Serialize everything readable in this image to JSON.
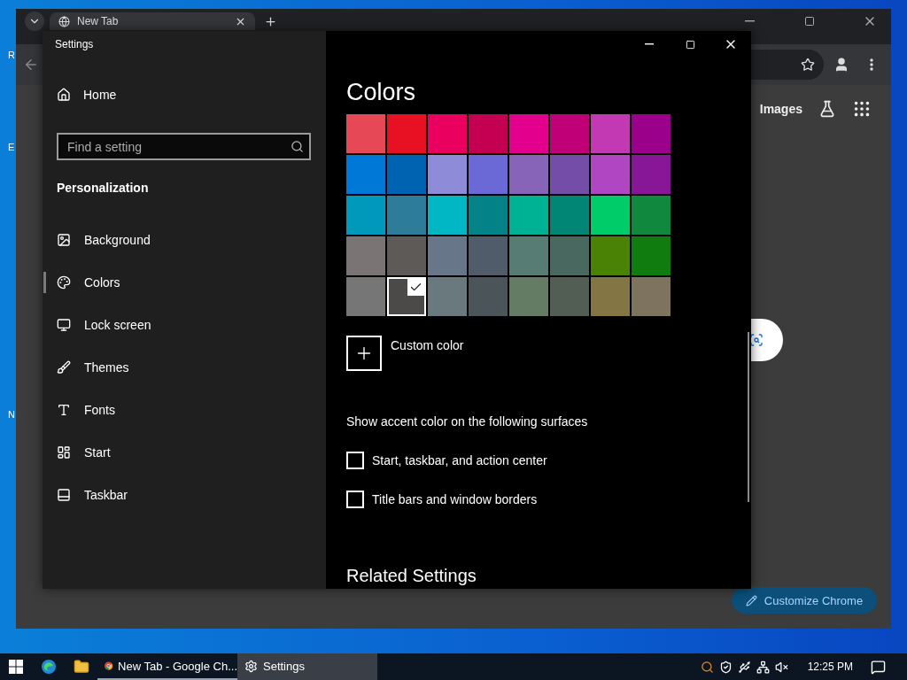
{
  "desktop": {
    "labels": [
      "R",
      "E",
      "N"
    ]
  },
  "browser": {
    "tab": {
      "title": "New Tab"
    },
    "images_link": "Images",
    "customize_button": "Customize Chrome"
  },
  "settings": {
    "title": "Settings",
    "home": "Home",
    "search": {
      "placeholder": "Find a setting"
    },
    "section": "Personalization",
    "nav": [
      {
        "label": "Background",
        "kind": "background",
        "selected": false
      },
      {
        "label": "Colors",
        "kind": "colors",
        "selected": true
      },
      {
        "label": "Lock screen",
        "kind": "lock",
        "selected": false
      },
      {
        "label": "Themes",
        "kind": "themes",
        "selected": false
      },
      {
        "label": "Fonts",
        "kind": "fonts",
        "selected": false
      },
      {
        "label": "Start",
        "kind": "start",
        "selected": false
      },
      {
        "label": "Taskbar",
        "kind": "taskbar",
        "selected": false
      }
    ],
    "page_title": "Colors",
    "swatches": [
      {
        "color": "#e74856",
        "selected": false
      },
      {
        "color": "#e81123",
        "selected": false
      },
      {
        "color": "#ea005e",
        "selected": false
      },
      {
        "color": "#c30052",
        "selected": false
      },
      {
        "color": "#e3008c",
        "selected": false
      },
      {
        "color": "#bf0077",
        "selected": false
      },
      {
        "color": "#c239b3",
        "selected": false
      },
      {
        "color": "#9a0089",
        "selected": false
      },
      {
        "color": "#0078d7",
        "selected": false
      },
      {
        "color": "#0063b1",
        "selected": false
      },
      {
        "color": "#8e8cd8",
        "selected": false
      },
      {
        "color": "#6b69d6",
        "selected": false
      },
      {
        "color": "#8764b8",
        "selected": false
      },
      {
        "color": "#744da9",
        "selected": false
      },
      {
        "color": "#b146c2",
        "selected": false
      },
      {
        "color": "#881798",
        "selected": false
      },
      {
        "color": "#0099bc",
        "selected": false
      },
      {
        "color": "#2d7d9a",
        "selected": false
      },
      {
        "color": "#00b7c3",
        "selected": false
      },
      {
        "color": "#038387",
        "selected": false
      },
      {
        "color": "#00b294",
        "selected": false
      },
      {
        "color": "#018574",
        "selected": false
      },
      {
        "color": "#00cc6a",
        "selected": false
      },
      {
        "color": "#10893e",
        "selected": false
      },
      {
        "color": "#7a7574",
        "selected": false
      },
      {
        "color": "#5d5a58",
        "selected": false
      },
      {
        "color": "#68768a",
        "selected": false
      },
      {
        "color": "#515c6b",
        "selected": false
      },
      {
        "color": "#567c73",
        "selected": false
      },
      {
        "color": "#486860",
        "selected": false
      },
      {
        "color": "#498205",
        "selected": false
      },
      {
        "color": "#107c10",
        "selected": false
      },
      {
        "color": "#767676",
        "selected": false
      },
      {
        "color": "#4c4a48",
        "selected": true
      },
      {
        "color": "#69797e",
        "selected": false
      },
      {
        "color": "#4a5459",
        "selected": false
      },
      {
        "color": "#647c64",
        "selected": false
      },
      {
        "color": "#525e54",
        "selected": false
      },
      {
        "color": "#847545",
        "selected": false
      },
      {
        "color": "#7e735f",
        "selected": false
      }
    ],
    "custom_color": "Custom color",
    "accent_heading": "Show accent color on the following surfaces",
    "accent_options": [
      {
        "label": "Start, taskbar, and action center",
        "checked": false
      },
      {
        "label": "Title bars and window borders",
        "checked": false
      }
    ],
    "related_heading": "Related Settings"
  },
  "taskbar": {
    "items": [
      {
        "label": "New Tab - Google Ch...",
        "kind": "chrome",
        "selected": false
      },
      {
        "label": "Settings",
        "kind": "settings",
        "selected": true
      }
    ],
    "clock": "12:25 PM"
  }
}
